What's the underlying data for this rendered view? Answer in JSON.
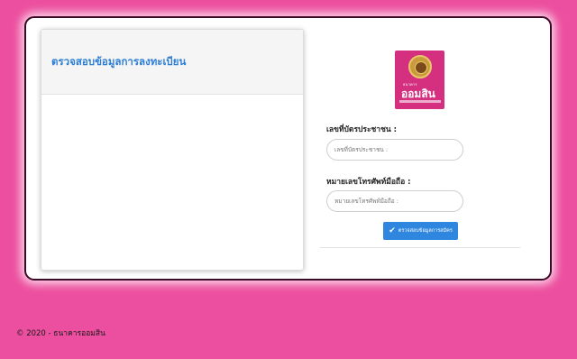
{
  "result_panel": {
    "title": "ตรวจสอบข้อมูลการลงทะเบียน"
  },
  "logo": {
    "small_text": "ธนาคาร",
    "brand_text": "ออมสิน"
  },
  "form": {
    "id_card_label": "เลขที่บัตรประชาชน :",
    "id_card_placeholder": "เลขที่บัตรประชาชน :",
    "id_card_value": "",
    "phone_label": "หมายเลขโทรศัพท์มือถือ :",
    "phone_placeholder": "หมายเลขโทรศัพท์มือถือ :",
    "phone_value": "",
    "submit_label": "ตรวจสอบข้อมูลการสมัคร",
    "submit_icon": "check-icon"
  },
  "footer": {
    "copyright": "© 2020 - ธนาคารออมสิน"
  },
  "colors": {
    "background": "#ec4f9f",
    "accent": "#2f86de",
    "title": "#2d7fd6",
    "logo_bg": "#d4307f"
  }
}
